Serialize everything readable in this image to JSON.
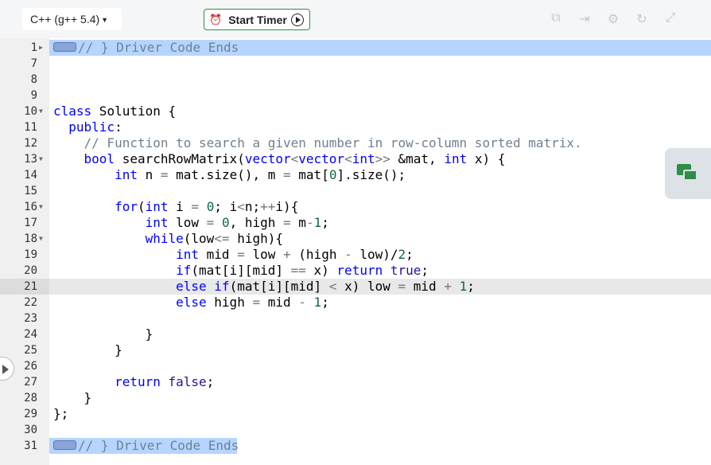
{
  "toolbar": {
    "language": "C++ (g++ 5.4)",
    "timer_label": "Start Timer",
    "icons": [
      "copy-icon",
      "fullscreen-enter-icon",
      "settings-icon",
      "reset-icon",
      "expand-icon"
    ]
  },
  "editor": {
    "active_line": 21,
    "lines": [
      {
        "n": "1",
        "fold": "▸",
        "text": "// } Driver Code Ends"
      },
      {
        "n": "7",
        "fold": "",
        "text": ""
      },
      {
        "n": "8",
        "fold": "",
        "text": ""
      },
      {
        "n": "9",
        "fold": "",
        "text": ""
      },
      {
        "n": "10",
        "fold": "▾",
        "text": "class Solution {"
      },
      {
        "n": "11",
        "fold": "",
        "text": "  public:"
      },
      {
        "n": "12",
        "fold": "",
        "text": "    // Function to search a given number in row-column sorted matrix."
      },
      {
        "n": "13",
        "fold": "▾",
        "text": "    bool searchRowMatrix(vector<vector<int>> &mat, int x) {"
      },
      {
        "n": "14",
        "fold": "",
        "text": "        int n = mat.size(), m = mat[0].size();"
      },
      {
        "n": "15",
        "fold": "",
        "text": ""
      },
      {
        "n": "16",
        "fold": "▾",
        "text": "        for(int i = 0; i<n;++i){"
      },
      {
        "n": "17",
        "fold": "",
        "text": "            int low = 0, high = m-1;"
      },
      {
        "n": "18",
        "fold": "▾",
        "text": "            while(low<= high){"
      },
      {
        "n": "19",
        "fold": "",
        "text": "                int mid = low + (high - low)/2;"
      },
      {
        "n": "20",
        "fold": "",
        "text": "                if(mat[i][mid] == x) return true;"
      },
      {
        "n": "21",
        "fold": "",
        "text": "                else if(mat[i][mid] < x) low = mid + 1;"
      },
      {
        "n": "22",
        "fold": "",
        "text": "                else high = mid - 1;"
      },
      {
        "n": "23",
        "fold": "",
        "text": ""
      },
      {
        "n": "24",
        "fold": "",
        "text": "            }"
      },
      {
        "n": "25",
        "fold": "",
        "text": "        }"
      },
      {
        "n": "26",
        "fold": "",
        "text": ""
      },
      {
        "n": "27",
        "fold": "",
        "text": "        return false;"
      },
      {
        "n": "28",
        "fold": "",
        "text": "    }"
      },
      {
        "n": "29",
        "fold": "",
        "text": "};"
      },
      {
        "n": "30",
        "fold": "",
        "text": ""
      },
      {
        "n": "31",
        "fold": "",
        "text": "// } Driver Code Ends"
      }
    ]
  }
}
